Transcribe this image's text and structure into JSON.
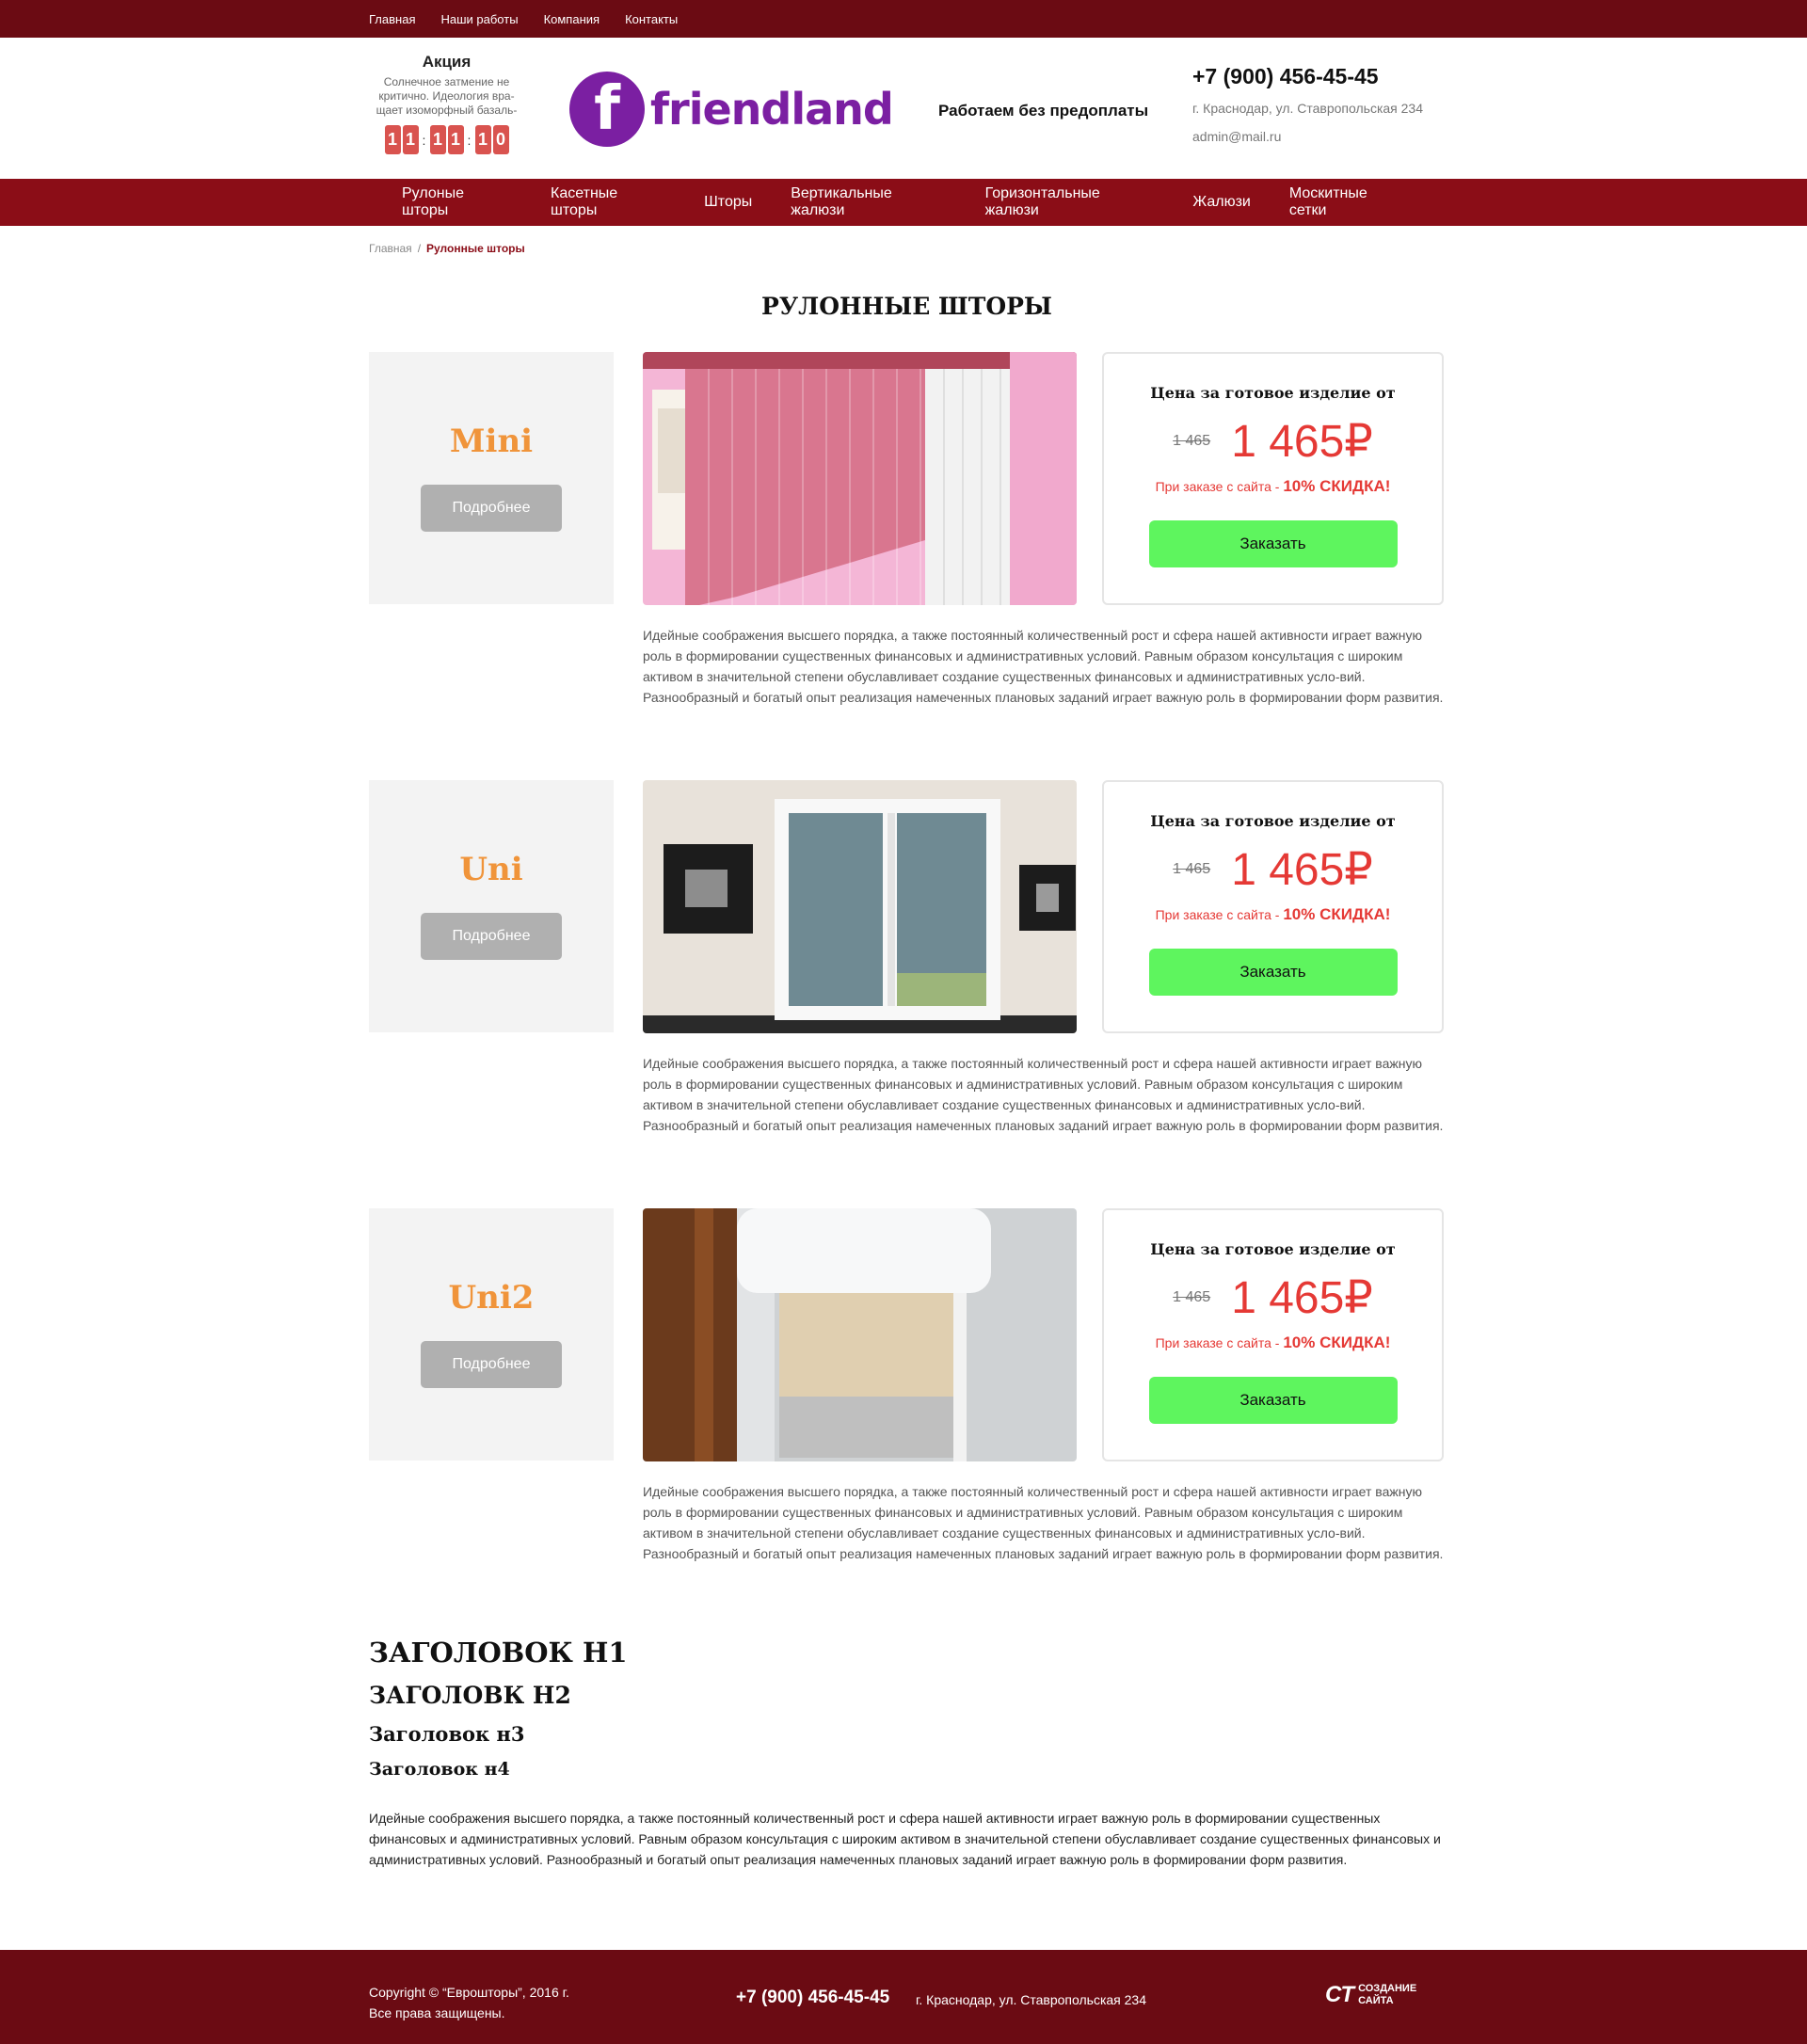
{
  "topbar": {
    "links": [
      "Главная",
      "Наши работы",
      "Компания",
      "Контакты"
    ]
  },
  "header": {
    "promo_title": "Акция",
    "promo_text": "Солнечное затмение не критично. Идеология вра-щает изоморфный базаль-",
    "timer": [
      "1",
      "1",
      "1",
      "1",
      "1",
      "0"
    ],
    "logo_text": "friendland",
    "slogan": "Работаем без предоплаты",
    "phone": "+7 (900) 456-45-45",
    "address": "г. Краснодар, ул. Ставропольская 234",
    "email": "admin@mail.ru"
  },
  "nav": {
    "items": [
      "Рулоные шторы",
      "Касетные шторы",
      "Шторы",
      "Вертикальные жалюзи",
      "Горизонтальные жалюзи",
      "Жалюзи",
      "Москитные сетки"
    ]
  },
  "breadcrumbs": {
    "home": "Главная",
    "separator": "/",
    "current": "Рулонные шторы"
  },
  "page_title": "РУЛОННЫЕ ШТОРЫ",
  "products": [
    {
      "name": "Mini",
      "more": "Подробнее",
      "price_label": "Цена за готовое изделие от",
      "old_price": "1 465",
      "new_price": "1 465₽",
      "discount_prefix": "При заказе с сайта - ",
      "discount_value": "10% СКИДКА!",
      "order": "Заказать",
      "description": "Идейные соображения высшего порядка, а также постоянный количественный рост и сфера нашей активности играет важную роль в формировании существенных финансовых и административных условий. Равным образом консультация с широким активом в значительной степени обуславливает создание существенных финансовых и административных усло-вий. Разнообразный и богатый опыт реализация намеченных плановых заданий играет важную роль в формировании форм развития."
    },
    {
      "name": "Uni",
      "more": "Подробнее",
      "price_label": "Цена за готовое изделие от",
      "old_price": "1 465",
      "new_price": "1 465₽",
      "discount_prefix": "При заказе с сайта - ",
      "discount_value": "10% СКИДКА!",
      "order": "Заказать",
      "description": "Идейные соображения высшего порядка, а также постоянный количественный рост и сфера нашей активности играет важную роль в формировании существенных финансовых и административных условий. Равным образом консультация с широким активом в значительной степени обуславливает создание существенных финансовых и административных усло-вий. Разнообразный и богатый опыт реализация намеченных плановых заданий играет важную роль в формировании форм развития."
    },
    {
      "name": "Uni2",
      "more": "Подробнее",
      "price_label": "Цена за готовое изделие от",
      "old_price": "1 465",
      "new_price": "1 465₽",
      "discount_prefix": "При заказе с сайта - ",
      "discount_value": "10% СКИДКА!",
      "order": "Заказать",
      "description": "Идейные соображения высшего порядка, а также постоянный количественный рост и сфера нашей активности играет важную роль в формировании существенных финансовых и административных условий. Равным образом консультация с широким активом в значительной степени обуславливает создание существенных финансовых и административных усло-вий. Разнообразный и богатый опыт реализация намеченных плановых заданий играет важную роль в формировании форм развития."
    }
  ],
  "headings": {
    "h1": "ЗАГОЛОВОК Н1",
    "h2": "ЗАГОЛОВК Н2",
    "h3": "Заголовок н3",
    "h4": "Заголовок н4",
    "text": "Идейные соображения высшего порядка, а также постоянный количественный рост и сфера нашей активности играет важную роль в формировании существенных финансовых и административных условий. Равным образом консультация с широким активом в значительной степени обуславливает создание существенных финансовых и административных условий. Разнообразный и богатый опыт реализация намеченных плановых заданий играет важную роль в формировании форм развития."
  },
  "footer": {
    "copyright": "Copyright © “Еврошторы”, 2016 г.",
    "rights": "Все права защищены.",
    "phone": "+7 (900) 456-45-45",
    "address": "г. Краснодар, ул. Ставропольская 234",
    "dev_mark": "СТ",
    "dev_line1": "СОЗДАНИЕ",
    "dev_line2": "САЙТА"
  },
  "colors": {
    "topbar": "#6b0b13",
    "nav": "#8b0d17",
    "accent_orange": "#f0943a",
    "price_red": "#e53935",
    "order_green": "#5ef55e"
  }
}
